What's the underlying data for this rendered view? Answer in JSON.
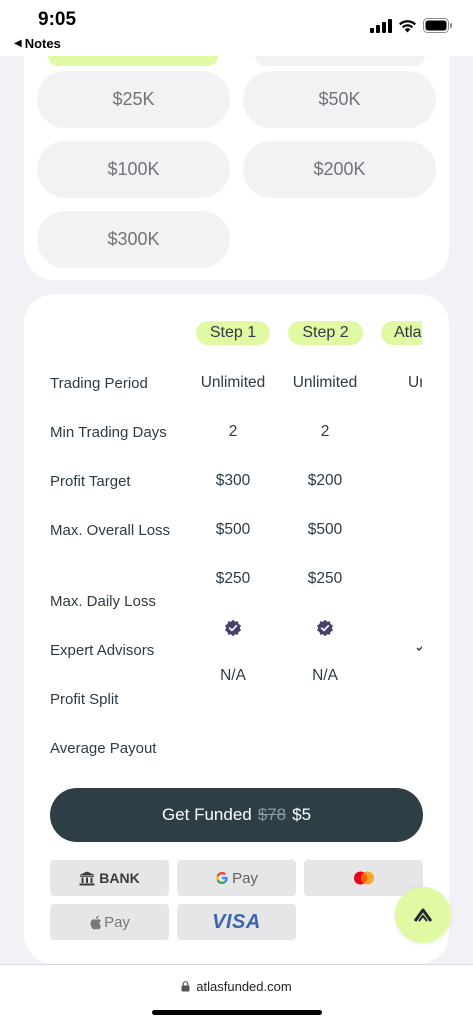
{
  "status": {
    "time": "9:05",
    "back_label": "Notes"
  },
  "amounts": [
    "$25K",
    "$50K",
    "$100K",
    "$200K",
    "$300K"
  ],
  "steps": [
    "Step 1",
    "Step 2",
    "Atlas"
  ],
  "rows": [
    "Trading Period",
    "Min Trading Days",
    "Profit Target",
    "Max. Overall Loss",
    "Max. Daily Loss",
    "Expert Advisors",
    "Profit Split",
    "Average Payout"
  ],
  "step1_values": {
    "trading_period": "Unlimited",
    "min_days": "2",
    "profit_target": "$300",
    "overall_loss": "$500",
    "daily_loss": "$250",
    "profit_split": "N/A"
  },
  "step2_values": {
    "trading_period": "Unlimited",
    "min_days": "2",
    "profit_target": "$200",
    "overall_loss": "$500",
    "daily_loss": "$250",
    "profit_split": "N/A"
  },
  "step3_partial": {
    "trading_period": "Unlimited"
  },
  "cta": {
    "label": "Get Funded",
    "old_price": "$78",
    "new_price": "$5"
  },
  "payments": {
    "bank": "BANK",
    "gpay": "Pay",
    "apple_pay": "Pay",
    "visa": "VISA"
  },
  "browser": {
    "url": "atlasfunded.com"
  },
  "colors": {
    "accent": "#e2f9a4",
    "dark": "#2d3f45",
    "pill_bg": "#f2f2f4",
    "badge": "#4a3f6b"
  },
  "icons": {
    "status": [
      "cellular-signal-icon",
      "wifi-icon",
      "battery-icon"
    ],
    "verified": "verified-badge-icon",
    "fab": "chevron-up-icon",
    "lock": "lock-icon"
  }
}
